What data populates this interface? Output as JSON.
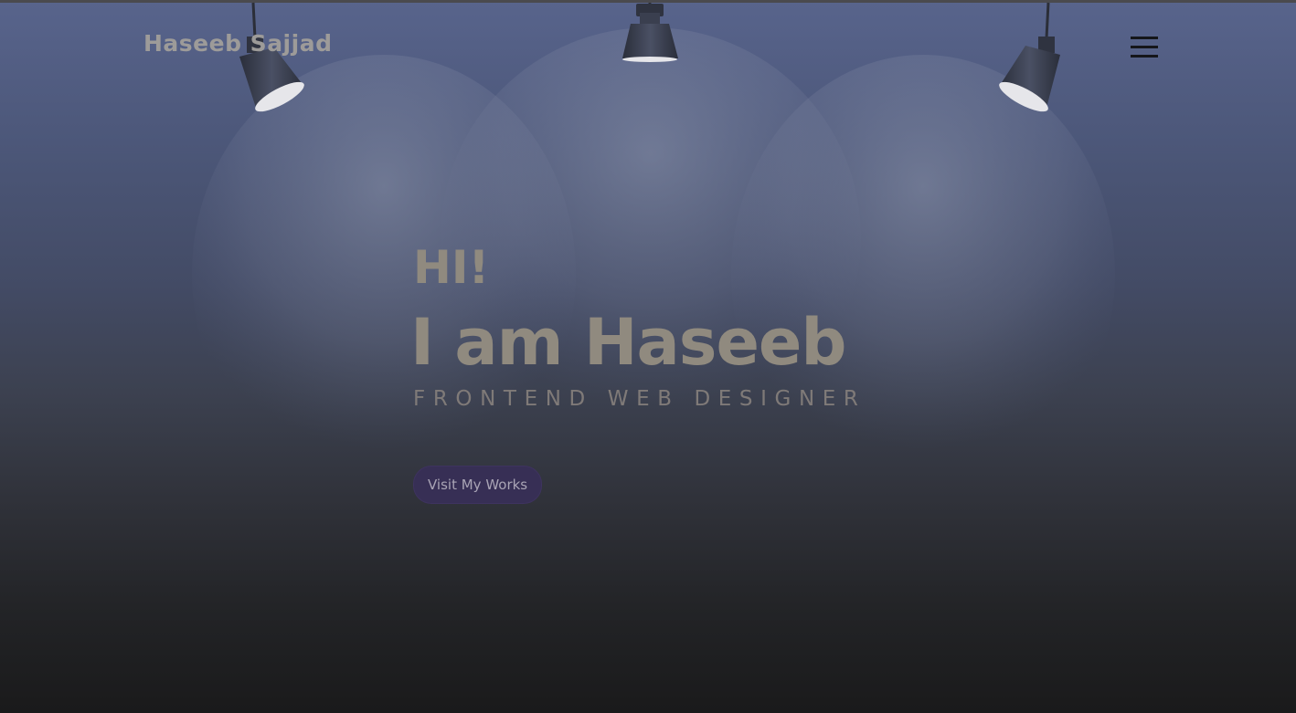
{
  "header": {
    "logo_text": "Haseeb Sajjad",
    "menu_icon": "hamburger-menu-icon"
  },
  "hero": {
    "greeting": "HI!",
    "headline": "I am Haseeb",
    "role": "FRONTEND WEB DESIGNER",
    "cta_label": "Visit My Works"
  },
  "decor": {
    "lamp_icon": "spotlight-lamp-icon",
    "lamp_count": 3
  },
  "colors": {
    "background_top": "#58648c",
    "background_bottom": "#1a1a1b",
    "heading_text": "#908a7f",
    "button_bg": "#372f55",
    "menu_icon": "#15161a"
  }
}
